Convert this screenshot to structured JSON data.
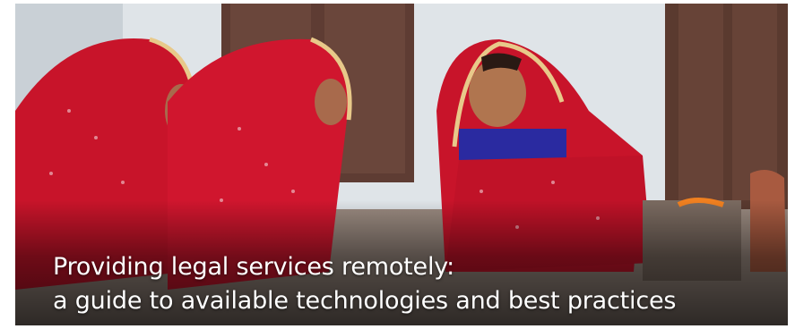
{
  "banner": {
    "headline_line1": "Providing legal services remotely:",
    "headline_line2": "a guide to available technologies and best practices",
    "colors": {
      "sari_red": "#c8142a",
      "wall_white": "#e8ecef",
      "door_brown": "#5b3a30",
      "text": "#ffffff"
    }
  }
}
